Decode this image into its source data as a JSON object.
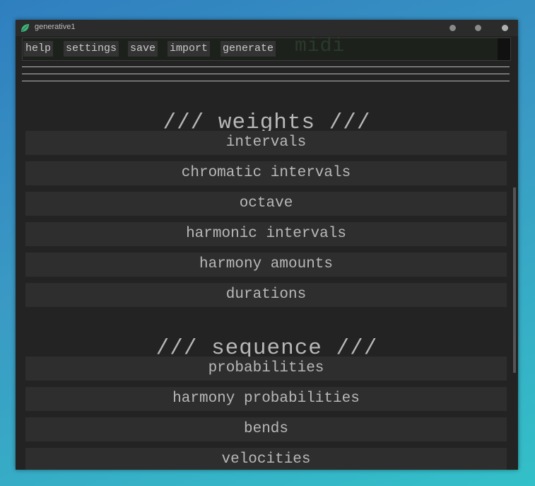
{
  "window": {
    "title": "generative1"
  },
  "menu": {
    "ghost_text": "midi",
    "buttons": [
      "help",
      "settings",
      "save",
      "import",
      "generate"
    ]
  },
  "weights": {
    "title": "/// weights ///",
    "items": [
      "intervals",
      "chromatic intervals",
      "octave",
      "harmonic intervals",
      "harmony amounts",
      "durations"
    ]
  },
  "sequence": {
    "title": "/// sequence ///",
    "items": [
      "probabilities",
      "harmony probabilities",
      "bends",
      "velocities"
    ]
  },
  "colors": {
    "background": "#232323",
    "button": "#2e2e2e",
    "text": "#b8b8b8",
    "app_icon": "#3fb57a"
  }
}
